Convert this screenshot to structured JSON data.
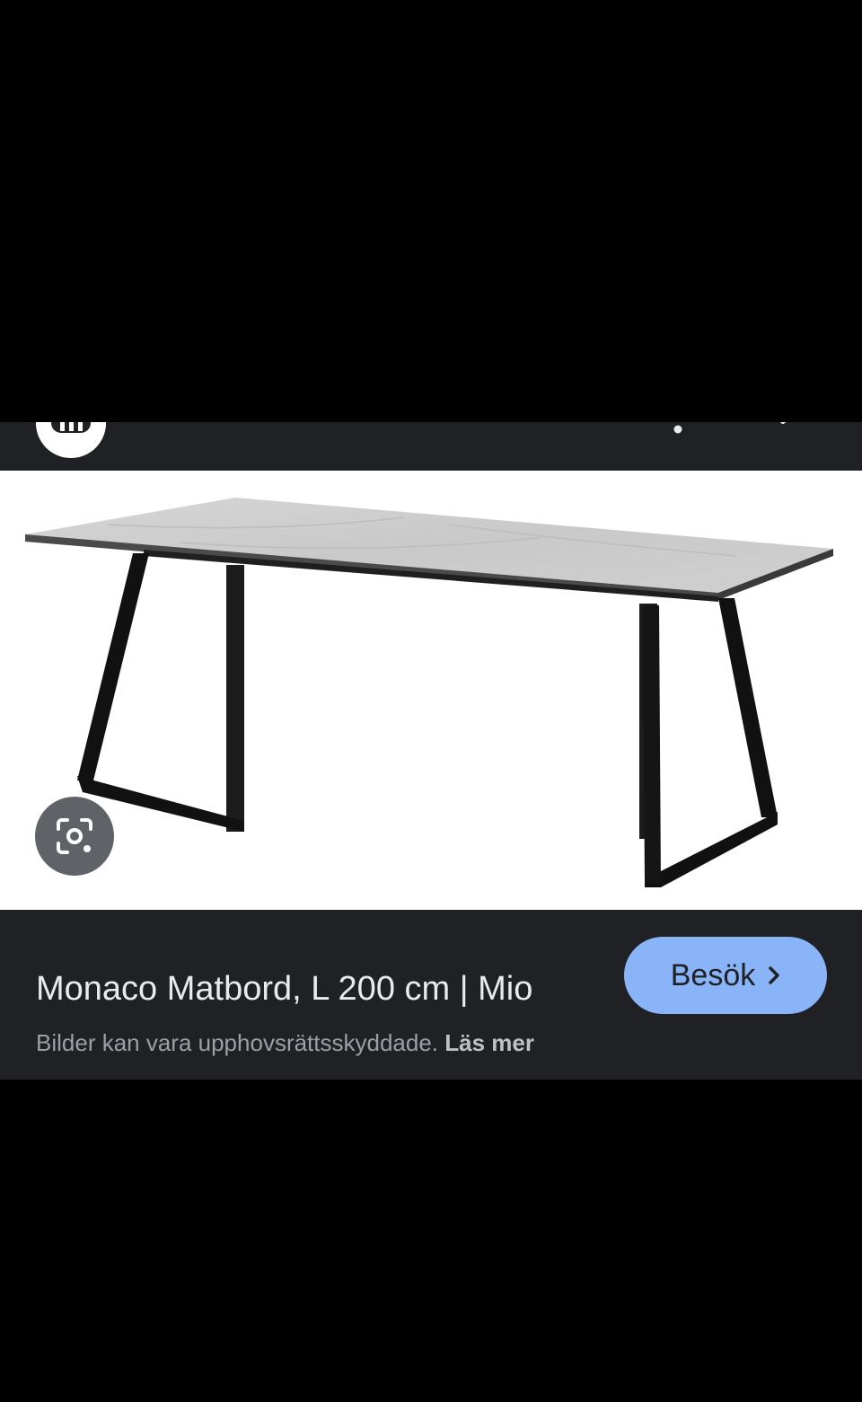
{
  "header": {
    "site_logo_icon": "globe-logo-icon",
    "more_icon": "more-vert-icon",
    "close_icon": "close-icon"
  },
  "image": {
    "subject_icon": "dining-table-photo",
    "lens_icon": "google-lens-icon"
  },
  "result": {
    "title": "Monaco Matbord, L 200 cm | Mio",
    "visit_label": "Besök",
    "visit_icon": "chevron-right-icon",
    "notice_text": "Bilder kan vara upphovsrättsskyddade.",
    "read_more_label": "Läs mer"
  },
  "colors": {
    "panel": "#202124",
    "button": "#8ab4f8",
    "title_text": "#e8eaed",
    "muted_text": "#9aa0a6"
  }
}
